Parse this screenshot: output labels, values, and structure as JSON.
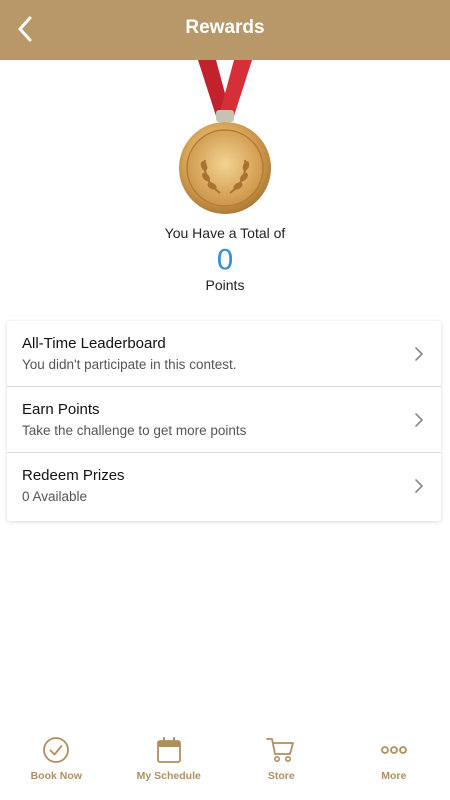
{
  "header": {
    "title": "Rewards",
    "back_icon": "chevron-left-icon"
  },
  "summary": {
    "total_label": "You Have a Total of",
    "points": "0",
    "points_label": "Points"
  },
  "menu": [
    {
      "title": "All-Time Leaderboard",
      "subtitle": "You didn't participate in this contest."
    },
    {
      "title": "Earn Points",
      "subtitle": "Take the challenge to get more points"
    },
    {
      "title": "Redeem Prizes",
      "subtitle": "0 Available"
    }
  ],
  "tabs": [
    {
      "label": "Book Now",
      "icon": "check-circle-icon"
    },
    {
      "label": "My Schedule",
      "icon": "calendar-icon"
    },
    {
      "label": "Store",
      "icon": "cart-icon"
    },
    {
      "label": "More",
      "icon": "more-dots-icon"
    }
  ],
  "colors": {
    "accent": "#b89868",
    "points": "#3b8ed8",
    "tab_label": "#b08f5f"
  }
}
